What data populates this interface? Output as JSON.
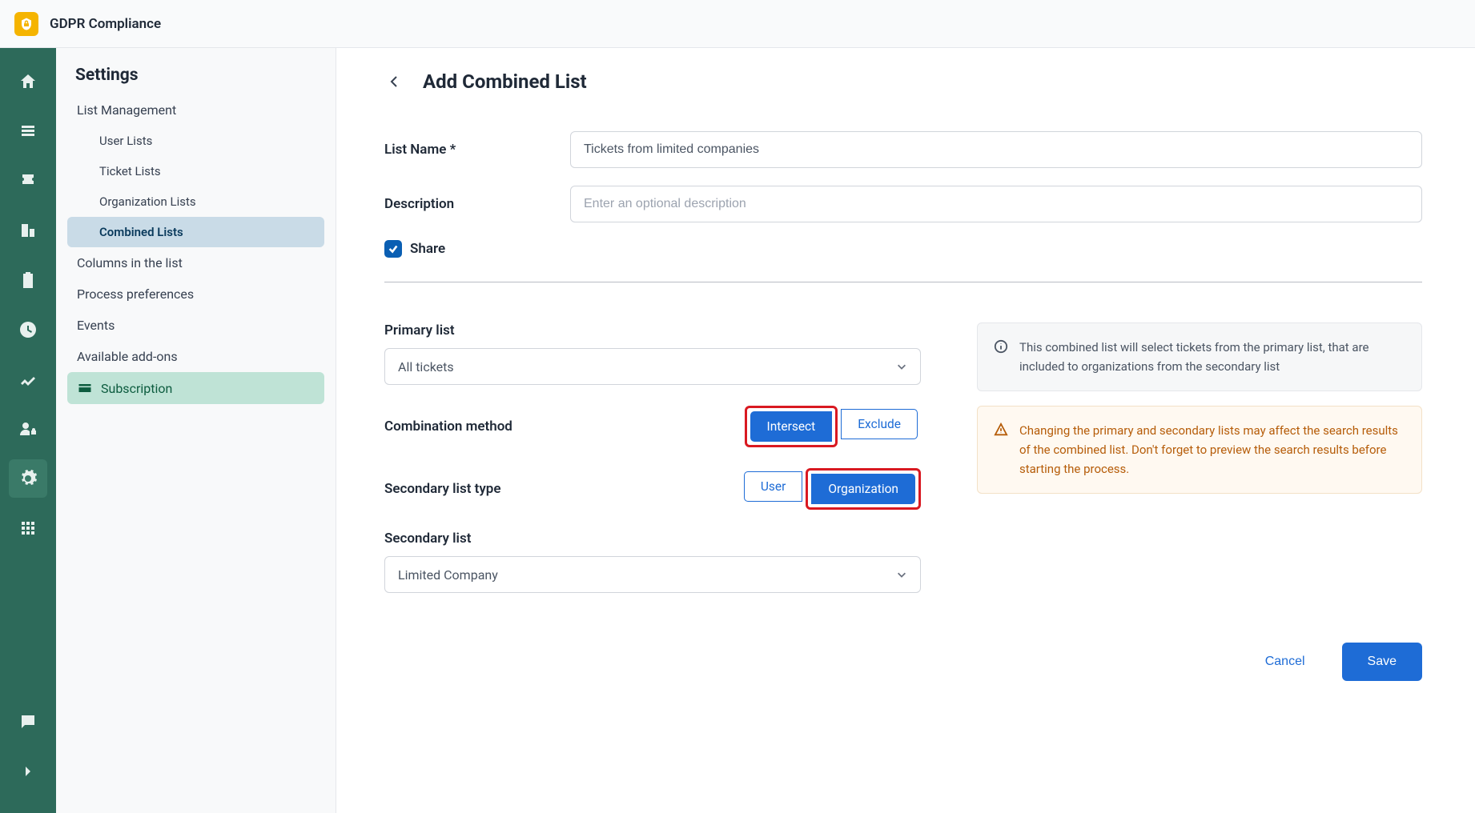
{
  "header": {
    "app_title": "GDPR Compliance"
  },
  "sidebar": {
    "title": "Settings",
    "items": [
      {
        "label": "List Management"
      },
      {
        "label": "User Lists"
      },
      {
        "label": "Ticket Lists"
      },
      {
        "label": "Organization Lists"
      },
      {
        "label": "Combined Lists"
      },
      {
        "label": "Columns in the list"
      },
      {
        "label": "Process preferences"
      },
      {
        "label": "Events"
      },
      {
        "label": "Available add-ons"
      },
      {
        "label": "Subscription"
      }
    ]
  },
  "page": {
    "title": "Add Combined List"
  },
  "form": {
    "list_name_label": "List Name *",
    "list_name_value": "Tickets from limited companies",
    "description_label": "Description",
    "description_placeholder": "Enter an optional description",
    "share_label": "Share",
    "share_checked": true
  },
  "primary_list": {
    "label": "Primary list",
    "value": "All tickets"
  },
  "combination": {
    "label": "Combination method",
    "options": [
      "Intersect",
      "Exclude"
    ],
    "selected": "Intersect"
  },
  "secondary_type": {
    "label": "Secondary list type",
    "options": [
      "User",
      "Organization"
    ],
    "selected": "Organization"
  },
  "secondary_list": {
    "label": "Secondary list",
    "value": "Limited Company"
  },
  "alerts": {
    "info": "This combined list will select tickets from the primary list, that are included to organizations from the secondary list",
    "warn": "Changing the primary and secondary lists may affect the search results of the combined list. Don't forget to preview the search results before starting the process."
  },
  "actions": {
    "cancel": "Cancel",
    "save": "Save"
  }
}
